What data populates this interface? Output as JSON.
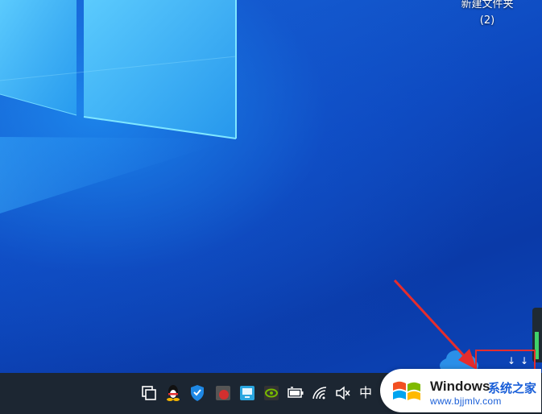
{
  "desktop": {
    "icons": [
      {
        "label": "新建文件夹\n(2)"
      }
    ]
  },
  "taskbar": {
    "tray_icons": [
      {
        "name": "task-view-icon"
      },
      {
        "name": "qq-penguin-icon"
      },
      {
        "name": "security-shield-icon"
      },
      {
        "name": "red-app-icon"
      },
      {
        "name": "monitor-app-icon"
      },
      {
        "name": "nvidia-icon"
      },
      {
        "name": "battery-icon"
      },
      {
        "name": "wifi-icon"
      },
      {
        "name": "volume-muted-icon"
      }
    ],
    "ime_label": "中"
  },
  "watermark": {
    "brand": "Windows",
    "brand_cn": "系统之家",
    "url": "www.bjjmlv.com"
  },
  "colors": {
    "annotation": "#e52d2d",
    "taskbar": "#1c2632",
    "brand_blue": "#1a5fd8"
  }
}
